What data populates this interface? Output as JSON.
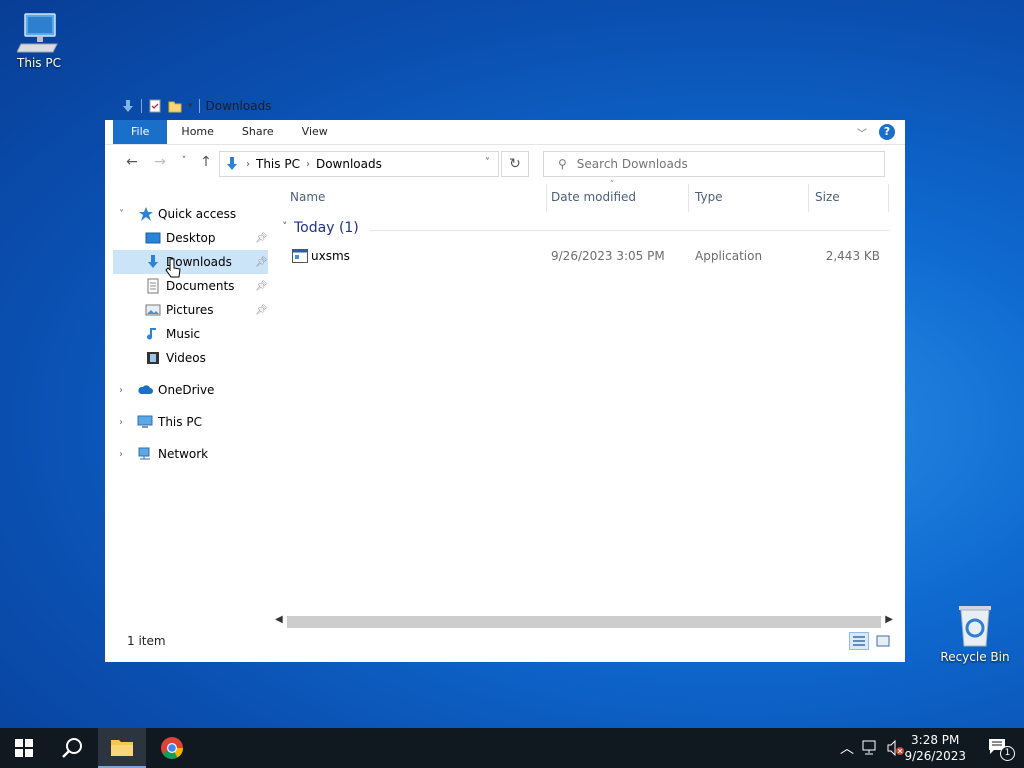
{
  "desktop": {
    "icons": [
      {
        "label": "This PC"
      },
      {
        "label": "Recycle Bin"
      }
    ]
  },
  "window": {
    "title": "Downloads",
    "ribbon_tabs": [
      "File",
      "Home",
      "Share",
      "View"
    ],
    "help_label": "?",
    "address": {
      "crumbs": [
        "This PC",
        "Downloads"
      ]
    },
    "search_placeholder": "Search Downloads",
    "nav": {
      "quick_access": "Quick access",
      "items": [
        {
          "label": "Desktop",
          "pinned": true
        },
        {
          "label": "Downloads",
          "pinned": true,
          "selected": true
        },
        {
          "label": "Documents",
          "pinned": true
        },
        {
          "label": "Pictures",
          "pinned": true
        },
        {
          "label": "Music",
          "pinned": false
        },
        {
          "label": "Videos",
          "pinned": false
        }
      ],
      "onedrive": "OneDrive",
      "this_pc": "This PC",
      "network": "Network"
    },
    "columns": [
      "Name",
      "Date modified",
      "Type",
      "Size"
    ],
    "group": {
      "label": "Today (1)"
    },
    "files": [
      {
        "name": "uxsms",
        "date": "9/26/2023 3:05 PM",
        "type": "Application",
        "size": "2,443 KB"
      }
    ],
    "status": "1 item"
  },
  "taskbar": {
    "time": "3:28 PM",
    "date": "9/26/2023",
    "notification_count": "1"
  },
  "colors": {
    "accent": "#1a6fc9",
    "selection": "#cce4f7",
    "taskbar": "#101820"
  }
}
